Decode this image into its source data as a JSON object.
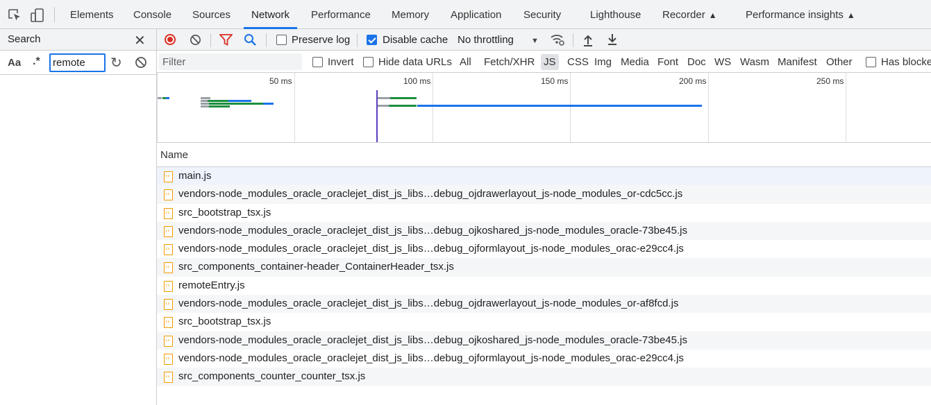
{
  "tabs": [
    {
      "label": "Elements"
    },
    {
      "label": "Console"
    },
    {
      "label": "Sources"
    },
    {
      "label": "Network"
    },
    {
      "label": "Performance"
    },
    {
      "label": "Memory"
    },
    {
      "label": "Application"
    },
    {
      "label": "Security"
    },
    {
      "label": "Lighthouse"
    },
    {
      "label": "Recorder"
    },
    {
      "label": "Performance insights"
    }
  ],
  "active_tab": "Network",
  "search_panel": {
    "title": "Search",
    "case_label": "Aa",
    "regex_label": ".*",
    "query": "remote"
  },
  "toolbar": {
    "preserve_log": "Preserve log",
    "preserve_log_checked": false,
    "disable_cache": "Disable cache",
    "disable_cache_checked": true,
    "throttling": "No throttling"
  },
  "filter": {
    "placeholder": "Filter",
    "invert": "Invert",
    "hide_data_urls": "Hide data URLs",
    "types": [
      "All",
      "Fetch/XHR",
      "JS",
      "CSS",
      "Img",
      "Media",
      "Font",
      "Doc",
      "WS",
      "Wasm",
      "Manifest",
      "Other"
    ],
    "active_type": "JS",
    "has_blocked": "Has blocke"
  },
  "timeline": {
    "ticks": [
      "50 ms",
      "100 ms",
      "150 ms",
      "200 ms",
      "250 ms"
    ]
  },
  "table": {
    "column_name": "Name",
    "rows": [
      "main.js",
      "vendors-node_modules_oracle_oraclejet_dist_js_libs…debug_ojdrawerlayout_js-node_modules_or-cdc5cc.js",
      "src_bootstrap_tsx.js",
      "vendors-node_modules_oracle_oraclejet_dist_js_libs…debug_ojkoshared_js-node_modules_oracle-73be45.js",
      "vendors-node_modules_oracle_oraclejet_dist_js_libs…debug_ojformlayout_js-node_modules_orac-e29cc4.js",
      "src_components_container-header_ContainerHeader_tsx.js",
      "remoteEntry.js",
      "vendors-node_modules_oracle_oraclejet_dist_js_libs…debug_ojdrawerlayout_js-node_modules_or-af8fcd.js",
      "src_bootstrap_tsx.js",
      "vendors-node_modules_oracle_oraclejet_dist_js_libs…debug_ojkoshared_js-node_modules_oracle-73be45.js",
      "vendors-node_modules_oracle_oraclejet_dist_js_libs…debug_ojformlayout_js-node_modules_orac-e29cc4.js",
      "src_components_counter_counter_tsx.js"
    ]
  },
  "colors": {
    "accent": "#1a73e8",
    "record": "#d93025",
    "js_file": "#f29900"
  }
}
